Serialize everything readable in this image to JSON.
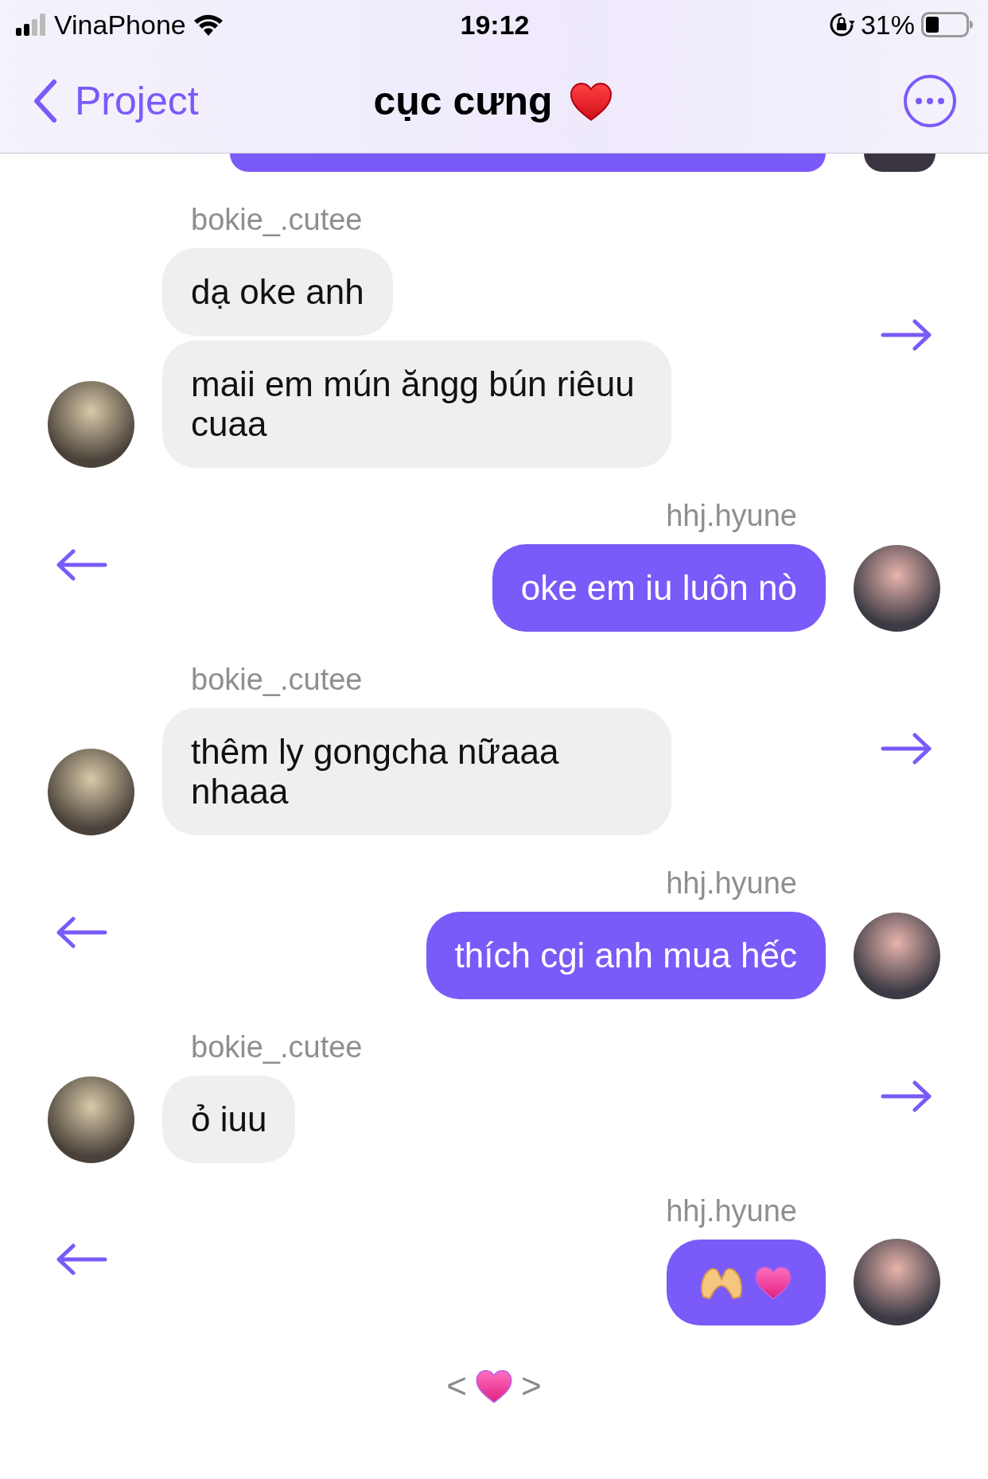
{
  "status_bar": {
    "carrier": "VinaPhone",
    "time": "19:12",
    "battery": "31%"
  },
  "nav": {
    "back_label": "Project",
    "title": "cục cưng"
  },
  "messages": [
    {
      "kind": "received",
      "sender": "bokie_.cutee",
      "bubbles": [
        {
          "kind": "text",
          "text": "dạ oke anh"
        },
        {
          "kind": "text",
          "text": "maii em mún ăngg bún riêuu cuaa"
        }
      ]
    },
    {
      "kind": "sent",
      "sender": "hhj.hyune",
      "bubbles": [
        {
          "kind": "text",
          "text": "oke em iu luôn nò"
        }
      ]
    },
    {
      "kind": "received",
      "sender": "bokie_.cutee",
      "bubbles": [
        {
          "kind": "text",
          "text": "thêm ly gongcha nữaaa nhaaa"
        }
      ]
    },
    {
      "kind": "sent",
      "sender": "hhj.hyune",
      "bubbles": [
        {
          "kind": "text",
          "text": "thích cgi anh mua hếc"
        }
      ]
    },
    {
      "kind": "received",
      "sender": "bokie_.cutee",
      "bubbles": [
        {
          "kind": "text",
          "text": "ỏ iuu"
        }
      ]
    },
    {
      "kind": "sent",
      "sender": "hhj.hyune",
      "bubbles": [
        {
          "kind": "hearts"
        }
      ]
    }
  ],
  "pager": {
    "prev": "<",
    "next": ">"
  }
}
